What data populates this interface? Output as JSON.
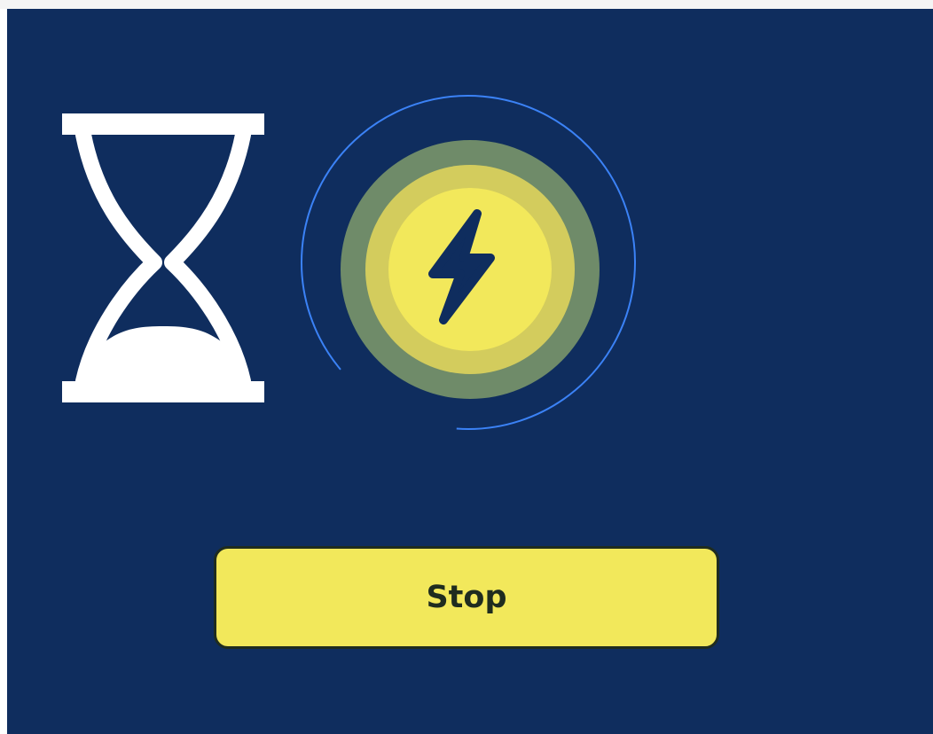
{
  "stop_button": {
    "label": "Stop"
  },
  "icons": {
    "hourglass": "hourglass-icon",
    "charging": "lightning-bolt-icon"
  },
  "colors": {
    "panel_background": "#0f2d5e",
    "accent_yellow": "#f2e85b",
    "ring_blue": "#3b82f6",
    "icon_white": "#ffffff"
  }
}
